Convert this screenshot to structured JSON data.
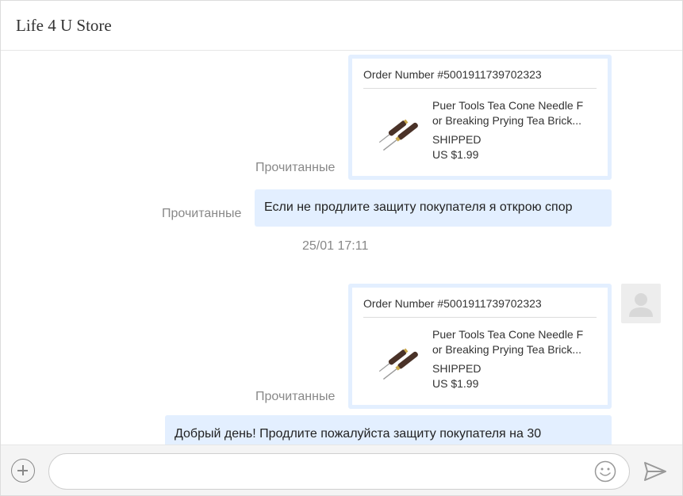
{
  "header": {
    "title": "Life 4 U Store"
  },
  "messages": {
    "order1": {
      "order_number": "Order Number #5001911739702323",
      "product_line1": "Puer Tools Tea Cone Needle F",
      "product_line2": "or Breaking Prying Tea Brick...",
      "status": "SHIPPED",
      "price": "US $1.99",
      "read_label": "Прочитанные"
    },
    "text1": {
      "text": "Если не продлите защиту покупателя я открою спор",
      "read_label": "Прочитанные"
    },
    "timestamp": "25/01 17:11",
    "order2": {
      "order_number": "Order Number #5001911739702323",
      "product_line1": "Puer Tools Tea Cone Needle F",
      "product_line2": "or Breaking Prying Tea Brick...",
      "status": "SHIPPED",
      "price": "US $1.99",
      "read_label": "Прочитанные"
    },
    "text2": {
      "text": "Добрый день! Продлите пожалуйста защиту покупателя на 30"
    }
  },
  "composer": {
    "input_value": "",
    "input_placeholder": "",
    "icons": [
      "add-icon",
      "emoji-icon",
      "send-icon"
    ]
  },
  "colors": {
    "bubble": "#e3efff",
    "muted_text": "#888888",
    "composer_bg": "#f4f4f4"
  }
}
